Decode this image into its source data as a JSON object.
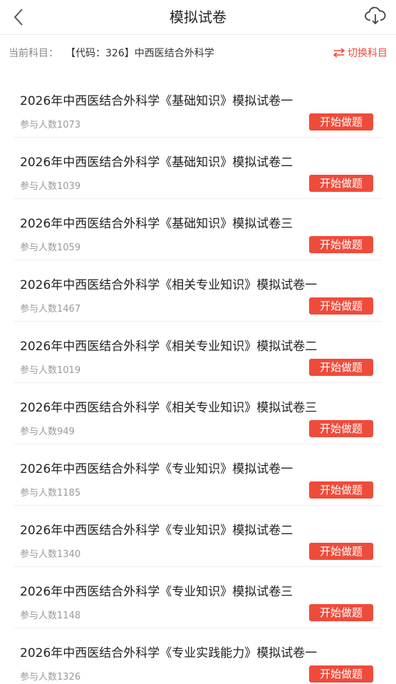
{
  "header": {
    "title": "模拟试卷",
    "back_icon": "chevron-left-icon",
    "download_icon": "cloud-download-icon"
  },
  "subject": {
    "prefix": "当前科目：",
    "name": "【代码：326】中西医结合外科学",
    "switch_label": "切换科目",
    "switch_icon": "swap-arrows-icon"
  },
  "colors": {
    "accent": "#ef4b3b",
    "muted_text": "#9a9a9a"
  },
  "papers": [
    {
      "title": "2026年中西医结合外科学《基础知识》模拟试卷一",
      "count": "参与人数1073",
      "button": "开始做题"
    },
    {
      "title": "2026年中西医结合外科学《基础知识》模拟试卷二",
      "count": "参与人数1039",
      "button": "开始做题"
    },
    {
      "title": "2026年中西医结合外科学《基础知识》模拟试卷三",
      "count": "参与人数1059",
      "button": "开始做题"
    },
    {
      "title": "2026年中西医结合外科学《相关专业知识》模拟试卷一",
      "count": "参与人数1467",
      "button": "开始做题"
    },
    {
      "title": "2026年中西医结合外科学《相关专业知识》模拟试卷二",
      "count": "参与人数1019",
      "button": "开始做题"
    },
    {
      "title": "2026年中西医结合外科学《相关专业知识》模拟试卷三",
      "count": "参与人数949",
      "button": "开始做题"
    },
    {
      "title": "2026年中西医结合外科学《专业知识》模拟试卷一",
      "count": "参与人数1185",
      "button": "开始做题"
    },
    {
      "title": "2026年中西医结合外科学《专业知识》模拟试卷二",
      "count": "参与人数1340",
      "button": "开始做题"
    },
    {
      "title": "2026年中西医结合外科学《专业知识》模拟试卷三",
      "count": "参与人数1148",
      "button": "开始做题"
    },
    {
      "title": "2026年中西医结合外科学《专业实践能力》模拟试卷一",
      "count": "参与人数1326",
      "button": "开始做题"
    }
  ]
}
